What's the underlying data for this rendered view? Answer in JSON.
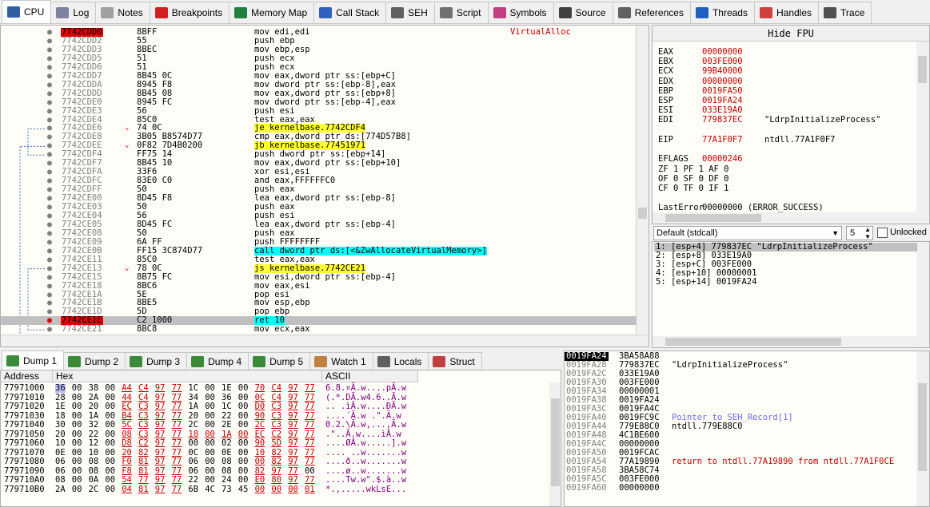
{
  "tabs": [
    {
      "label": "CPU",
      "icon": "cpu-icon",
      "color": "#3060a0"
    },
    {
      "label": "Log",
      "icon": "log-icon",
      "color": "#8080a0"
    },
    {
      "label": "Notes",
      "icon": "notes-icon",
      "color": "#a0a0a0"
    },
    {
      "label": "Breakpoints",
      "icon": "breakpoint-dot-icon",
      "color": "#d02020"
    },
    {
      "label": "Memory Map",
      "icon": "memory-map-icon",
      "color": "#208040"
    },
    {
      "label": "Call Stack",
      "icon": "call-stack-icon",
      "color": "#3060c0"
    },
    {
      "label": "SEH",
      "icon": "seh-icon",
      "color": "#606060"
    },
    {
      "label": "Script",
      "icon": "script-icon",
      "color": "#707070"
    },
    {
      "label": "Symbols",
      "icon": "symbols-icon",
      "color": "#c04080"
    },
    {
      "label": "Source",
      "icon": "source-icon",
      "color": "#404040"
    },
    {
      "label": "References",
      "icon": "references-icon",
      "color": "#606060"
    },
    {
      "label": "Threads",
      "icon": "threads-icon",
      "color": "#2060c0"
    },
    {
      "label": "Handles",
      "icon": "handles-icon",
      "color": "#d04040"
    },
    {
      "label": "Trace",
      "icon": "trace-icon",
      "color": "#505050"
    }
  ],
  "disasm": [
    {
      "addr": "7742CDD0",
      "bytes": "8BFF",
      "instr": "mov edi,edi",
      "cmt": "VirtualAlloc",
      "addrStyle": "eip"
    },
    {
      "addr": "7742CDD2",
      "bytes": "55",
      "instr": "push ebp",
      "cmt": ""
    },
    {
      "addr": "7742CDD3",
      "bytes": "8BEC",
      "instr": "mov ebp,esp",
      "cmt": ""
    },
    {
      "addr": "7742CDD5",
      "bytes": "51",
      "instr": "push ecx",
      "cmt": ""
    },
    {
      "addr": "7742CDD6",
      "bytes": "51",
      "instr": "push ecx",
      "cmt": ""
    },
    {
      "addr": "7742CDD7",
      "bytes": "8B45 0C",
      "instr": "mov eax,dword ptr ss:[ebp+C]",
      "cmt": ""
    },
    {
      "addr": "7742CDDA",
      "bytes": "8945 F8",
      "instr": "mov dword ptr ss:[ebp-8],eax",
      "cmt": ""
    },
    {
      "addr": "7742CDDD",
      "bytes": "8B45 08",
      "instr": "mov eax,dword ptr ss:[ebp+8]",
      "cmt": ""
    },
    {
      "addr": "7742CDE0",
      "bytes": "8945 FC",
      "instr": "mov dword ptr ss:[ebp-4],eax",
      "cmt": ""
    },
    {
      "addr": "7742CDE3",
      "bytes": "56",
      "instr": "push esi",
      "cmt": ""
    },
    {
      "addr": "7742CDE4",
      "bytes": "85C0",
      "instr": "test eax,eax",
      "cmt": ""
    },
    {
      "addr": "7742CDE6",
      "bytes": "74 0C",
      "instr": "je kernelbase.7742CDF4",
      "cmt": "",
      "jmp": true,
      "hl": "y"
    },
    {
      "addr": "7742CDE8",
      "bytes": "3B05 B8574D77",
      "instr": "cmp eax,dword ptr ds:[774D57B8]",
      "cmt": ""
    },
    {
      "addr": "7742CDEE",
      "bytes": "0F82 7D4B0200",
      "instr": "jb kernelbase.77451971",
      "cmt": "",
      "jmp": true,
      "hl": "y"
    },
    {
      "addr": "7742CDF4",
      "bytes": "FF75 14",
      "instr": "push dword ptr ss:[ebp+14]",
      "cmt": ""
    },
    {
      "addr": "7742CDF7",
      "bytes": "8B45 10",
      "instr": "mov eax,dword ptr ss:[ebp+10]",
      "cmt": ""
    },
    {
      "addr": "7742CDFA",
      "bytes": "33F6",
      "instr": "xor esi,esi",
      "cmt": ""
    },
    {
      "addr": "7742CDFC",
      "bytes": "83E0 C0",
      "instr": "and eax,FFFFFFC0",
      "cmt": ""
    },
    {
      "addr": "7742CDFF",
      "bytes": "50",
      "instr": "push eax",
      "cmt": ""
    },
    {
      "addr": "7742CE00",
      "bytes": "8D45 F8",
      "instr": "lea eax,dword ptr ss:[ebp-8]",
      "cmt": ""
    },
    {
      "addr": "7742CE03",
      "bytes": "50",
      "instr": "push eax",
      "cmt": ""
    },
    {
      "addr": "7742CE04",
      "bytes": "56",
      "instr": "push esi",
      "cmt": ""
    },
    {
      "addr": "7742CE05",
      "bytes": "8D45 FC",
      "instr": "lea eax,dword ptr ss:[ebp-4]",
      "cmt": ""
    },
    {
      "addr": "7742CE08",
      "bytes": "50",
      "instr": "push eax",
      "cmt": ""
    },
    {
      "addr": "7742CE09",
      "bytes": "6A FF",
      "instr": "push FFFFFFFF",
      "cmt": ""
    },
    {
      "addr": "7742CE0B",
      "bytes": "FF15 3C874D77",
      "instr": "call dword ptr ds:[<&ZwAllocateVirtualMemory>]",
      "cmt": "",
      "hl": "c"
    },
    {
      "addr": "7742CE11",
      "bytes": "85C0",
      "instr": "test eax,eax",
      "cmt": ""
    },
    {
      "addr": "7742CE13",
      "bytes": "78 0C",
      "instr": "js kernelbase.7742CE21",
      "cmt": "",
      "jmp": true,
      "hl": "y"
    },
    {
      "addr": "7742CE15",
      "bytes": "8B75 FC",
      "instr": "mov esi,dword ptr ss:[ebp-4]",
      "cmt": ""
    },
    {
      "addr": "7742CE18",
      "bytes": "8BC6",
      "instr": "mov eax,esi",
      "cmt": ""
    },
    {
      "addr": "7742CE1A",
      "bytes": "5E",
      "instr": "pop esi",
      "cmt": ""
    },
    {
      "addr": "7742CE1B",
      "bytes": "8BE5",
      "instr": "mov esp,ebp",
      "cmt": ""
    },
    {
      "addr": "7742CE1D",
      "bytes": "5D",
      "instr": "pop ebp",
      "cmt": ""
    },
    {
      "addr": "7742CE1E",
      "bytes": "C2 1000",
      "instr": "ret 10",
      "cmt": "",
      "addrStyle": "bp",
      "hl": "ret"
    },
    {
      "addr": "7742CE21",
      "bytes": "8BC8",
      "instr": "mov ecx,eax",
      "cmt": ""
    }
  ],
  "registers": {
    "hide_fpu": "Hide FPU",
    "gp": [
      {
        "name": "EAX",
        "value": "00000000",
        "cmt": ""
      },
      {
        "name": "EBX",
        "value": "003FE000",
        "cmt": ""
      },
      {
        "name": "ECX",
        "value": "99B40000",
        "cmt": ""
      },
      {
        "name": "EDX",
        "value": "00000000",
        "cmt": ""
      },
      {
        "name": "EBP",
        "value": "0019FA50",
        "cmt": ""
      },
      {
        "name": "ESP",
        "value": "0019FA24",
        "cmt": ""
      },
      {
        "name": "ESI",
        "value": "033E19A0",
        "cmt": ""
      },
      {
        "name": "EDI",
        "value": "779837EC",
        "cmt": "\"LdrpInitializeProcess\""
      }
    ],
    "eip": {
      "name": "EIP",
      "value": "77A1F0F7",
      "cmt": "ntdll.77A1F0F7"
    },
    "eflags": {
      "name": "EFLAGS",
      "value": "00000246"
    },
    "flags": [
      "ZF 1  PF 1  AF 0",
      "OF 0  SF 0  DF 0",
      "CF 0  TF 0  IF 1"
    ],
    "lasterror": {
      "name": "LastError",
      "value": "00000000 (ERROR_SUCCESS)"
    }
  },
  "callconv": {
    "label": "Default (stdcall)",
    "count": "5",
    "unlocked": "Unlocked"
  },
  "args": [
    "1: [esp+4] 779837EC \"LdrpInitializeProcess\"",
    "2: [esp+8] 033E19A0",
    "3: [esp+C] 003FE000",
    "4: [esp+10] 00000001",
    "5: [esp+14] 0019FA24"
  ],
  "dumptabs": [
    {
      "label": "Dump 1",
      "icon": "dump-icon"
    },
    {
      "label": "Dump 2",
      "icon": "dump-icon"
    },
    {
      "label": "Dump 3",
      "icon": "dump-icon"
    },
    {
      "label": "Dump 4",
      "icon": "dump-icon"
    },
    {
      "label": "Dump 5",
      "icon": "dump-icon"
    },
    {
      "label": "Watch 1",
      "icon": "watch-icon"
    },
    {
      "label": "Locals",
      "icon": "locals-icon"
    },
    {
      "label": "Struct",
      "icon": "struct-icon"
    }
  ],
  "dump": {
    "headers": {
      "address": "Address",
      "hex": "Hex",
      "ascii": "ASCII"
    },
    "rows": [
      {
        "addr": "77971000",
        "hex": [
          "36",
          "00",
          "38",
          "00",
          "A4",
          "C4",
          "97",
          "77",
          "1C",
          "00",
          "1E",
          "00",
          "70",
          "C4",
          "97",
          "77"
        ],
        "ptr": [
          4,
          5,
          6,
          7,
          12,
          13,
          14,
          15
        ],
        "ascii": "6.8.¤Ä.w....pÄ.w"
      },
      {
        "addr": "77971010",
        "hex": [
          "28",
          "00",
          "2A",
          "00",
          "44",
          "C4",
          "97",
          "77",
          "34",
          "00",
          "36",
          "00",
          "0C",
          "C4",
          "97",
          "77"
        ],
        "ptr": [
          4,
          5,
          6,
          7,
          12,
          13,
          14,
          15
        ],
        "ascii": "(.*.DÄ.w4.6..Ä.w"
      },
      {
        "addr": "77971020",
        "hex": [
          "1E",
          "00",
          "20",
          "00",
          "EC",
          "C3",
          "97",
          "77",
          "1A",
          "00",
          "1C",
          "00",
          "D0",
          "C3",
          "97",
          "77"
        ],
        "ptr": [
          4,
          5,
          6,
          7,
          12,
          13,
          14,
          15
        ],
        "ascii": ".. .ìÃ.w....ÐÃ.w"
      },
      {
        "addr": "77971030",
        "hex": [
          "18",
          "00",
          "1A",
          "00",
          "B4",
          "C3",
          "97",
          "77",
          "20",
          "00",
          "22",
          "00",
          "90",
          "C3",
          "97",
          "77"
        ],
        "ptr": [
          4,
          5,
          6,
          7,
          12,
          13,
          14,
          15
        ],
        "ascii": "....´Ã.w .\".Ã.w"
      },
      {
        "addr": "77971040",
        "hex": [
          "30",
          "00",
          "32",
          "00",
          "5C",
          "C3",
          "97",
          "77",
          "2C",
          "00",
          "2E",
          "00",
          "2C",
          "C3",
          "97",
          "77"
        ],
        "ptr": [
          4,
          5,
          6,
          7,
          12,
          13,
          14,
          15
        ],
        "ascii": "0.2.\\Ã.w,...,Ã.w"
      },
      {
        "addr": "77971050",
        "hex": [
          "20",
          "00",
          "22",
          "00",
          "08",
          "C3",
          "97",
          "77",
          "18",
          "00",
          "1A",
          "00",
          "EC",
          "C2",
          "97",
          "77"
        ],
        "ptr": [
          4,
          5,
          6,
          7,
          8,
          9,
          10,
          11,
          12,
          13,
          14,
          15
        ],
        "ascii": " .\"..Ã.w....ìÂ.w"
      },
      {
        "addr": "77971060",
        "hex": [
          "10",
          "00",
          "12",
          "00",
          "D8",
          "C2",
          "97",
          "77",
          "00",
          "00",
          "02",
          "00",
          "90",
          "5D",
          "97",
          "77"
        ],
        "ptr": [
          4,
          5,
          6,
          7,
          12,
          13,
          14,
          15
        ],
        "ascii": "....ØÂ.w.....].w"
      },
      {
        "addr": "77971070",
        "hex": [
          "0E",
          "00",
          "10",
          "00",
          "20",
          "82",
          "97",
          "77",
          "0C",
          "00",
          "0E",
          "00",
          "10",
          "82",
          "97",
          "77"
        ],
        "ptr": [
          4,
          5,
          6,
          7,
          12,
          13,
          14,
          15
        ],
        "ascii": ".... ..w.......w"
      },
      {
        "addr": "77971080",
        "hex": [
          "06",
          "00",
          "08",
          "00",
          "F0",
          "81",
          "97",
          "77",
          "06",
          "00",
          "08",
          "00",
          "00",
          "82",
          "97",
          "77"
        ],
        "ptr": [
          4,
          5,
          6,
          7,
          12,
          13,
          14,
          15
        ],
        "ascii": "....ð..w.......w"
      },
      {
        "addr": "77971090",
        "hex": [
          "06",
          "00",
          "08",
          "00",
          "F8",
          "81",
          "97",
          "77",
          "06",
          "00",
          "08",
          "00",
          "82",
          "97",
          "77",
          "00"
        ],
        "ptr": [
          4,
          5,
          6,
          7,
          12,
          13,
          14
        ],
        "ascii": "....ø..w.......w"
      },
      {
        "addr": "779710A0",
        "hex": [
          "08",
          "00",
          "0A",
          "00",
          "54",
          "77",
          "97",
          "77",
          "22",
          "00",
          "24",
          "00",
          "E0",
          "80",
          "97",
          "77"
        ],
        "ptr": [
          4,
          5,
          6,
          7,
          12,
          13,
          14,
          15
        ],
        "ascii": "....Tw.w\".$.à..w"
      },
      {
        "addr": "779710B0",
        "hex": [
          "2A",
          "00",
          "2C",
          "00",
          "04",
          "81",
          "97",
          "77",
          "6B",
          "4C",
          "73",
          "45",
          "00",
          "00",
          "00",
          "01"
        ],
        "ptr": [
          4,
          5,
          6,
          7,
          12,
          13,
          14,
          15
        ],
        "ascii": "*.,.....wkLsE..."
      }
    ]
  },
  "stack": [
    {
      "addr": "0019FA24",
      "val": "3BA58A88",
      "cmt": "",
      "cur": true
    },
    {
      "addr": "0019FA28",
      "val": "779837EC",
      "cmt": "\"LdrpInitializeProcess\""
    },
    {
      "addr": "0019FA2C",
      "val": "033E19A0",
      "cmt": ""
    },
    {
      "addr": "0019FA30",
      "val": "003FE000",
      "cmt": ""
    },
    {
      "addr": "0019FA34",
      "val": "00000001",
      "cmt": ""
    },
    {
      "addr": "0019FA38",
      "val": "0019FA24",
      "cmt": ""
    },
    {
      "addr": "0019FA3C",
      "val": "0019FA4C",
      "cmt": ""
    },
    {
      "addr": "0019FA40",
      "val": "0019FC9C",
      "cmt": "Pointer to SEH_Record[1]",
      "cmtColor": "#6a6aff"
    },
    {
      "addr": "0019FA44",
      "val": "779E88C0",
      "cmt": "ntdll.779E88C0"
    },
    {
      "addr": "0019FA48",
      "val": "4C1BE600",
      "cmt": ""
    },
    {
      "addr": "0019FA4C",
      "val": "00000000",
      "cmt": ""
    },
    {
      "addr": "0019FA50",
      "val": "0019FCAC",
      "cmt": ""
    },
    {
      "addr": "0019FA54",
      "val": "77A19890",
      "cmt": "return to ntdll.77A19890 from ntdll.77A1F0CE",
      "cmtColor": "#c00000"
    },
    {
      "addr": "0019FA58",
      "val": "3BA58C74",
      "cmt": ""
    },
    {
      "addr": "0019FA5C",
      "val": "003FE000",
      "cmt": ""
    },
    {
      "addr": "0019FA60",
      "val": "00000000",
      "cmt": ""
    }
  ]
}
